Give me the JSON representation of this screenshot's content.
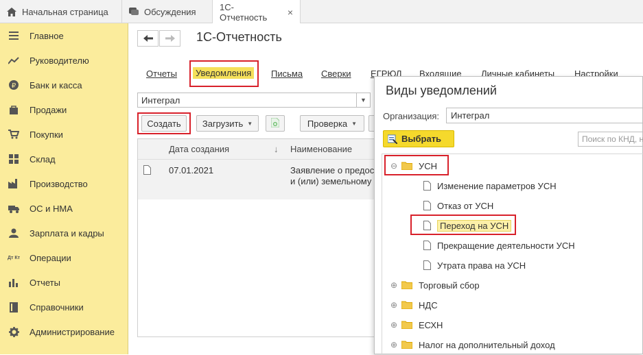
{
  "tabs": [
    {
      "label": "Начальная страница",
      "icon": "home-icon"
    },
    {
      "label": "Обсуждения",
      "icon": "chat-icon"
    },
    {
      "label": "1С-Отчетность",
      "icon": "",
      "close": "×"
    }
  ],
  "sidebar": {
    "items": [
      {
        "label": "Главное",
        "icon": "menu-icon"
      },
      {
        "label": "Руководителю",
        "icon": "trend-icon"
      },
      {
        "label": "Банк и касса",
        "icon": "ruble-icon"
      },
      {
        "label": "Продажи",
        "icon": "bag-icon"
      },
      {
        "label": "Покупки",
        "icon": "cart-icon"
      },
      {
        "label": "Склад",
        "icon": "grid-icon"
      },
      {
        "label": "Производство",
        "icon": "factory-icon"
      },
      {
        "label": "ОС и НМА",
        "icon": "truck-icon"
      },
      {
        "label": "Зарплата и кадры",
        "icon": "person-icon"
      },
      {
        "label": "Операции",
        "icon": "dt-kt-icon",
        "icon_text": "Дт Кт"
      },
      {
        "label": "Отчеты",
        "icon": "bar-chart-icon"
      },
      {
        "label": "Справочники",
        "icon": "book-icon"
      },
      {
        "label": "Администрирование",
        "icon": "gear-icon"
      }
    ]
  },
  "main": {
    "title": "1С-Отчетность",
    "menu": [
      "Отчеты",
      "Уведомления",
      "Письма",
      "Сверки",
      "ЕГРЮЛ",
      "Входящие",
      "Личные кабинеты",
      "Настройки"
    ],
    "selected_menu": "Уведомления",
    "org_value": "Интеграл",
    "buttons": {
      "create": "Создать",
      "load": "Загрузить",
      "check": "Проверка"
    },
    "grid": {
      "columns": [
        "Дата создания",
        "Наименование"
      ],
      "rows": [
        {
          "date": "07.01.2021",
          "name_line1": "Заявление о предос",
          "name_line2": "и (или) земельному"
        }
      ]
    }
  },
  "dialog": {
    "title": "Виды уведомлений",
    "org_label": "Организация:",
    "org_value": "Интеграл",
    "choose_label": "Выбрать",
    "search_placeholder": "Поиск по КНД, н",
    "tree": [
      {
        "label": "УСН",
        "expanded": true,
        "children": [
          "Изменение параметров УСН",
          "Отказ от УСН",
          "Переход на УСН",
          "Прекращение деятельности УСН",
          "Утрата права на УСН"
        ]
      },
      {
        "label": "Торговый сбор"
      },
      {
        "label": "НДС"
      },
      {
        "label": "ЕСХН"
      },
      {
        "label": "Налог на дополнительный доход"
      }
    ],
    "highlighted_item": "Переход на УСН"
  },
  "colors": {
    "sidebar_bg": "#fbec9c",
    "accent_yellow": "#f5d92c",
    "highlight_red": "#d8202a"
  }
}
